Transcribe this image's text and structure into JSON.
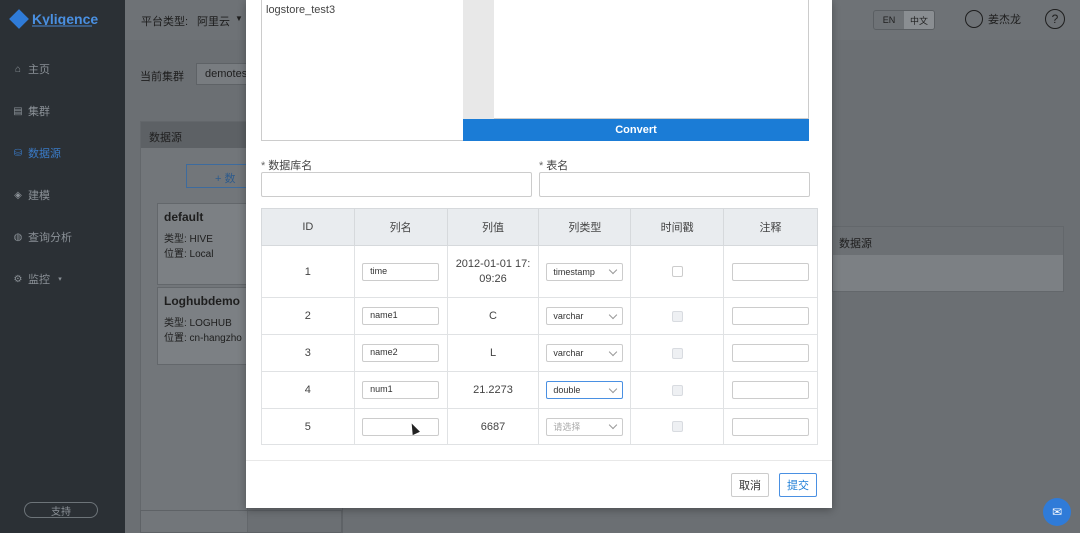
{
  "sidebar": {
    "brand": "Kyligence",
    "items": [
      {
        "label": "主页",
        "icon": "home-icon",
        "active": false
      },
      {
        "label": "集群",
        "icon": "cluster-icon",
        "active": false
      },
      {
        "label": "数据源",
        "icon": "datasource-icon",
        "active": true
      },
      {
        "label": "建模",
        "icon": "model-icon",
        "active": false
      },
      {
        "label": "查询分析",
        "icon": "query-icon",
        "active": false
      },
      {
        "label": "监控",
        "icon": "monitor-icon",
        "active": false
      }
    ],
    "support": "支持"
  },
  "header": {
    "platform_label": "平台类型:",
    "platform_value": "阿里云",
    "lang_en": "EN",
    "lang_zh": "中文",
    "user_name": "姜杰龙",
    "help": "?"
  },
  "background": {
    "cluster_label": "当前集群",
    "cluster_value": "demotes",
    "ds_panel_title": "数据源",
    "add_ds": "+ 数",
    "cards": [
      {
        "name": "default",
        "type": "类型: HIVE",
        "location": "位置: Local"
      },
      {
        "name": "Loghubdemo",
        "type": "类型: LOGHUB",
        "location": "位置: cn-hangzho"
      }
    ],
    "right_header": "数据源"
  },
  "modal": {
    "source_items": [
      "logstore_test3"
    ],
    "convert": "Convert",
    "db_label": "数据库名",
    "table_label": "表名",
    "columns": [
      "ID",
      "列名",
      "列值",
      "列类型",
      "时间戳",
      "注释"
    ],
    "rows": [
      {
        "id": "1",
        "name": "time",
        "value": "2012-01-01 17:09:26",
        "value_l1": "2012-01-01 17:",
        "value_l2": "09:26",
        "type": "timestamp",
        "placeholder": false,
        "focus": false,
        "checkbox_disabled": false
      },
      {
        "id": "2",
        "name": "name1",
        "value": "C",
        "type": "varchar",
        "placeholder": false,
        "focus": false,
        "checkbox_disabled": true
      },
      {
        "id": "3",
        "name": "name2",
        "value": "L",
        "type": "varchar",
        "placeholder": false,
        "focus": false,
        "checkbox_disabled": true
      },
      {
        "id": "4",
        "name": "num1",
        "value": "21.2273",
        "type": "double",
        "placeholder": false,
        "focus": true,
        "checkbox_disabled": true
      },
      {
        "id": "5",
        "name": "",
        "value": "6687",
        "type": "请选择",
        "placeholder": true,
        "focus": false,
        "checkbox_disabled": true
      }
    ],
    "cancel": "取消",
    "submit": "提交"
  },
  "colors": {
    "accent": "#1b7cd6",
    "sidebar_bg": "#2b3035",
    "overlay_bg": "#6b6f73"
  }
}
